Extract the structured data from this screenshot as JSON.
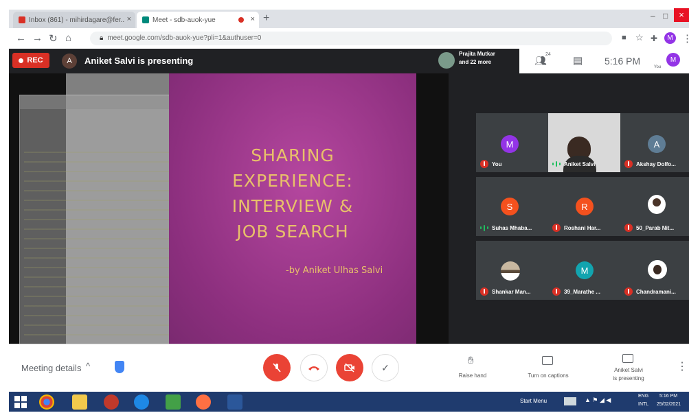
{
  "browser": {
    "tabs": [
      {
        "title": "Inbox (861) - mihirdagare@fer...",
        "active": false
      },
      {
        "title": "Meet - sdb-auok-yue",
        "active": true
      }
    ],
    "new_tab_symbol": "+",
    "window_controls": [
      "–",
      "□",
      "×"
    ],
    "url": "meet.google.com/sdb-auok-yue?pli=1&authuser=0",
    "profile_letter": "M",
    "colors": {
      "tabbar": "#dee1e6",
      "active_tab": "#ffffff"
    }
  },
  "meet": {
    "recording_label": "REC",
    "presenter_avatar_letter": "A",
    "presenting_text": "Aniket Salvi is presenting",
    "participants_preview": {
      "line1": "Prajita Mutkar",
      "line2": "and 22 more"
    },
    "people_count": "24",
    "time": "5:16 PM",
    "self_label": "You",
    "self_avatar_letter": "M",
    "slide": {
      "lines": [
        "SHARING",
        "EXPERIENCE:",
        "INTERVIEW &",
        "JOB SEARCH"
      ],
      "author": "-by Aniket Ulhas Salvi",
      "colors": {
        "background": "#9a3a8c",
        "text": "#e8c06a"
      }
    },
    "participants": [
      {
        "name": "You",
        "avatar_letter": "M",
        "avatar_color": "#9334e6",
        "mic": "off",
        "video": false
      },
      {
        "name": "Aniket Salvi",
        "avatar_letter": "",
        "avatar_color": "",
        "mic": "on",
        "video": true
      },
      {
        "name": "Akshay Dolfo...",
        "avatar_letter": "A",
        "avatar_color": "#5f7d95",
        "mic": "off",
        "video": false
      },
      {
        "name": "Suhas Mhaba...",
        "avatar_letter": "S",
        "avatar_color": "#f4511e",
        "mic": "on",
        "video": false
      },
      {
        "name": "Roshani Har...",
        "avatar_letter": "R",
        "avatar_color": "#f4511e",
        "mic": "off",
        "video": false
      },
      {
        "name": "50_Parab Nit...",
        "avatar_letter": "",
        "avatar_color": "#ffffff",
        "mic": "off",
        "video": false
      },
      {
        "name": "Shankar Man...",
        "avatar_letter": "",
        "avatar_color": "#c8b8a0",
        "mic": "off",
        "video": false
      },
      {
        "name": "39_Marathe ...",
        "avatar_letter": "M",
        "avatar_color": "#12a4af",
        "mic": "off",
        "video": false
      },
      {
        "name": "Chandramani...",
        "avatar_letter": "",
        "avatar_color": "#ffffff",
        "mic": "off",
        "video": false
      }
    ],
    "bottom": {
      "meeting_details": "Meeting details",
      "raise_hand": "Raise hand",
      "captions": "Turn on captions",
      "presenting_line1": "Aniket Salvi",
      "presenting_line2": "is presenting",
      "colors": {
        "danger": "#ea4335"
      }
    }
  },
  "taskbar": {
    "start_menu_label": "Start Menu",
    "lang_line1": "ENG",
    "lang_line2": "INTL",
    "time": "5:16 PM",
    "date": "25/02/2021"
  }
}
